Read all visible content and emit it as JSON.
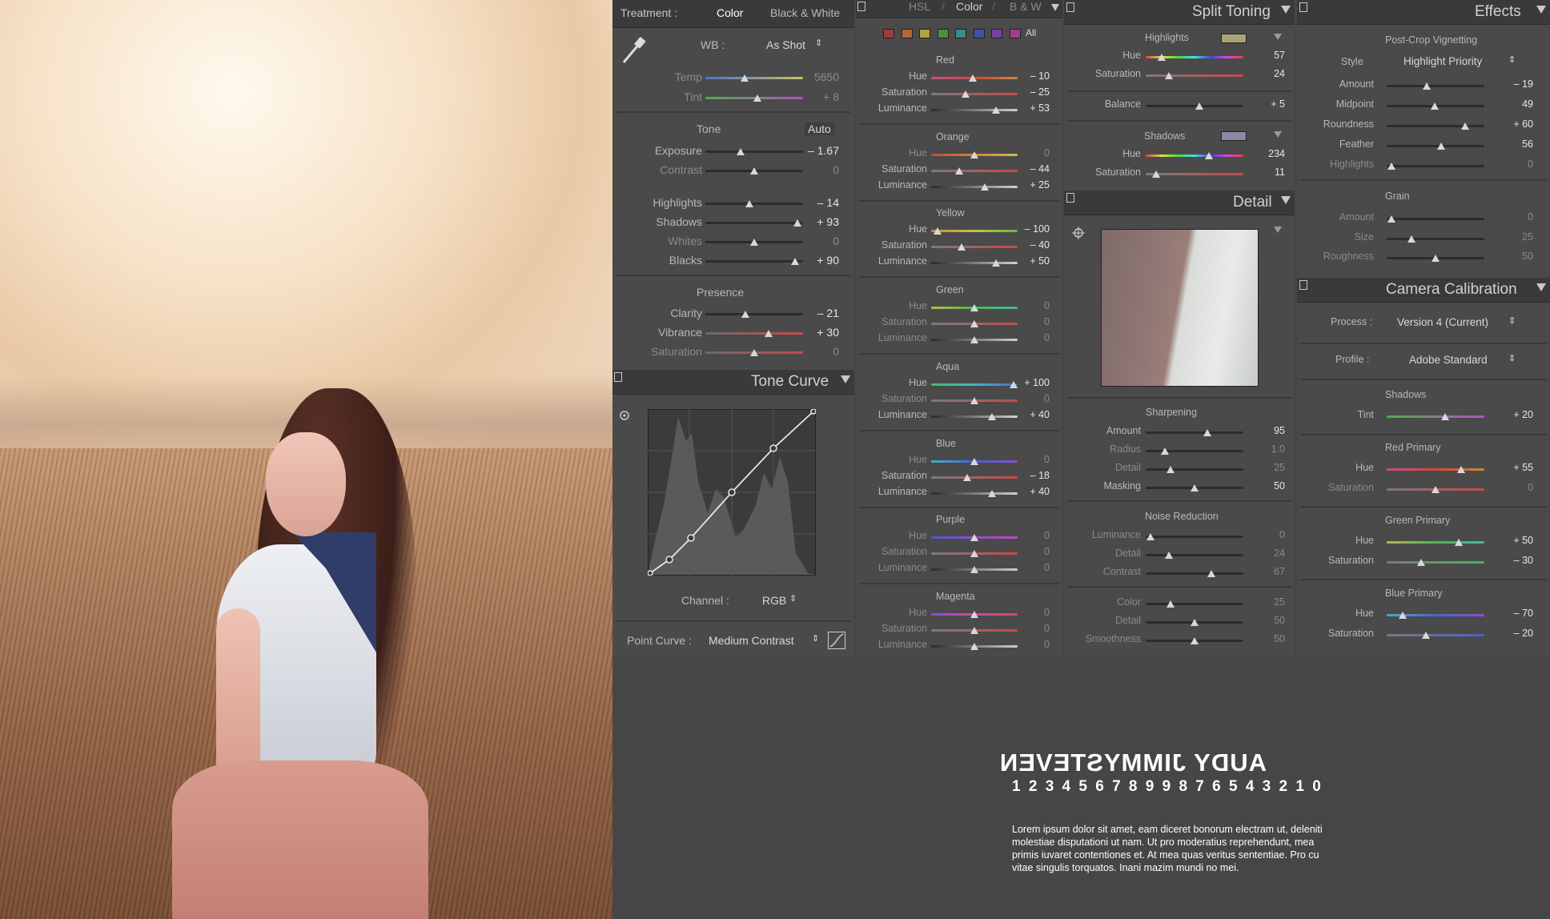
{
  "basic": {
    "treatment_label": "Treatment :",
    "treatment_color": "Color",
    "treatment_bw": "Black & White",
    "wb_label": "WB :",
    "wb_value": "As Shot",
    "temp_label": "Temp",
    "temp_value": "5650",
    "tint_label": "Tint",
    "tint_value": "+ 8",
    "tone_label": "Tone",
    "auto_label": "Auto",
    "exposure_label": "Exposure",
    "exposure_value": "– 1.67",
    "contrast_label": "Contrast",
    "contrast_value": "0",
    "highlights_label": "Highlights",
    "highlights_value": "– 14",
    "shadows_label": "Shadows",
    "shadows_value": "+ 93",
    "whites_label": "Whites",
    "whites_value": "0",
    "blacks_label": "Blacks",
    "blacks_value": "+ 90",
    "presence_label": "Presence",
    "clarity_label": "Clarity",
    "clarity_value": "– 21",
    "vibrance_label": "Vibrance",
    "vibrance_value": "+ 30",
    "saturation_label": "Saturation",
    "saturation_value": "0"
  },
  "tone_curve": {
    "title": "Tone Curve",
    "channel_label": "Channel :",
    "channel_value": "RGB",
    "point_curve_label": "Point Curve :",
    "point_curve_value": "Medium Contrast"
  },
  "hsl": {
    "tab_hsl": "HSL",
    "tab_color": "Color",
    "tab_bw": "B & W",
    "all_label": "All",
    "swatch_colors": [
      "#a0393c",
      "#b46a36",
      "#b2a23a",
      "#4d8f3f",
      "#3d8a86",
      "#3d56a8",
      "#7a3fa4",
      "#a73d86"
    ],
    "hue_label": "Hue",
    "sat_label": "Saturation",
    "lum_label": "Luminance",
    "colors": [
      {
        "name": "Red",
        "hue": "– 10",
        "sat": "– 25",
        "lum": "+ 53"
      },
      {
        "name": "Orange",
        "hue": "0",
        "sat": "– 44",
        "lum": "+ 25"
      },
      {
        "name": "Yellow",
        "hue": "– 100",
        "sat": "– 40",
        "lum": "+ 50"
      },
      {
        "name": "Green",
        "hue": "0",
        "sat": "0",
        "lum": "0"
      },
      {
        "name": "Aqua",
        "hue": "+ 100",
        "sat": "0",
        "lum": "+ 40"
      },
      {
        "name": "Blue",
        "hue": "0",
        "sat": "– 18",
        "lum": "+ 40"
      },
      {
        "name": "Purple",
        "hue": "0",
        "sat": "0",
        "lum": "0"
      },
      {
        "name": "Magenta",
        "hue": "0",
        "sat": "0",
        "lum": "0"
      }
    ]
  },
  "split_toning": {
    "title": "Split Toning",
    "highlights_label": "Highlights",
    "highlights_color": "#a9a374",
    "hue_label": "Hue",
    "sat_label": "Saturation",
    "highlights_hue": "57",
    "highlights_sat": "24",
    "balance_label": "Balance",
    "balance_value": "+ 5",
    "shadows_label": "Shadows",
    "shadows_color": "#8a89a6",
    "shadows_hue": "234",
    "shadows_sat": "11"
  },
  "detail": {
    "title": "Detail",
    "sharpening_label": "Sharpening",
    "amount_label": "Amount",
    "amount_value": "95",
    "radius_label": "Radius",
    "radius_value": "1.0",
    "detail_label": "Detail",
    "detail_value": "25",
    "masking_label": "Masking",
    "masking_value": "50",
    "noise_label": "Noise Reduction",
    "luminance_label": "Luminance",
    "luminance_value": "0",
    "nr_detail_label": "Detail",
    "nr_detail_value": "24",
    "nr_contrast_label": "Contrast",
    "nr_contrast_value": "67",
    "color_label": "Color",
    "color_value": "25",
    "color_detail_label": "Detail",
    "color_detail_value": "50",
    "smoothness_label": "Smoothness",
    "smoothness_value": "50"
  },
  "effects": {
    "title": "Effects",
    "vignette_label": "Post-Crop Vignetting",
    "style_label": "Style",
    "style_value": "Highlight Priority",
    "amount_label": "Amount",
    "amount_value": "– 19",
    "midpoint_label": "Midpoint",
    "midpoint_value": "49",
    "roundness_label": "Roundness",
    "roundness_value": "+ 60",
    "feather_label": "Feather",
    "feather_value": "56",
    "highlights_label": "Highlights",
    "highlights_value": "0",
    "grain_label": "Grain",
    "grain_amount_label": "Amount",
    "grain_amount_value": "0",
    "size_label": "Size",
    "size_value": "25",
    "roughness_label": "Roughness",
    "roughness_value": "50"
  },
  "calibration": {
    "title": "Camera Calibration",
    "process_label": "Process :",
    "process_value": "Version 4 (Current)",
    "profile_label": "Profile :",
    "profile_value": "Adobe Standard",
    "shadows_label": "Shadows",
    "tint_label": "Tint",
    "tint_value": "+ 20",
    "red_label": "Red Primary",
    "hue_label": "Hue",
    "sat_label": "Saturation",
    "red_hue": "+ 55",
    "red_sat": "0",
    "green_label": "Green Primary",
    "green_hue": "+ 50",
    "green_sat": "– 30",
    "blue_label": "Blue Primary",
    "blue_hue": "– 70",
    "blue_sat": "– 20"
  },
  "branding": {
    "name": "AUDY JIMMYSTEVEN",
    "numbers": "1 2 3 4 5 6 7 8 9 9 8 7 6 5 4 3 2 1 0",
    "lorem": "Lorem ipsum dolor sit amet, eam diceret bonorum electram ut, deleniti molestiae disputationi ut nam. Ut pro moderatius reprehendunt, mea primis iuvaret contentiones et. At mea quas veritus sententiae. Pro cu vitae singulis torquatos. Inani mazim mundi no mei."
  }
}
